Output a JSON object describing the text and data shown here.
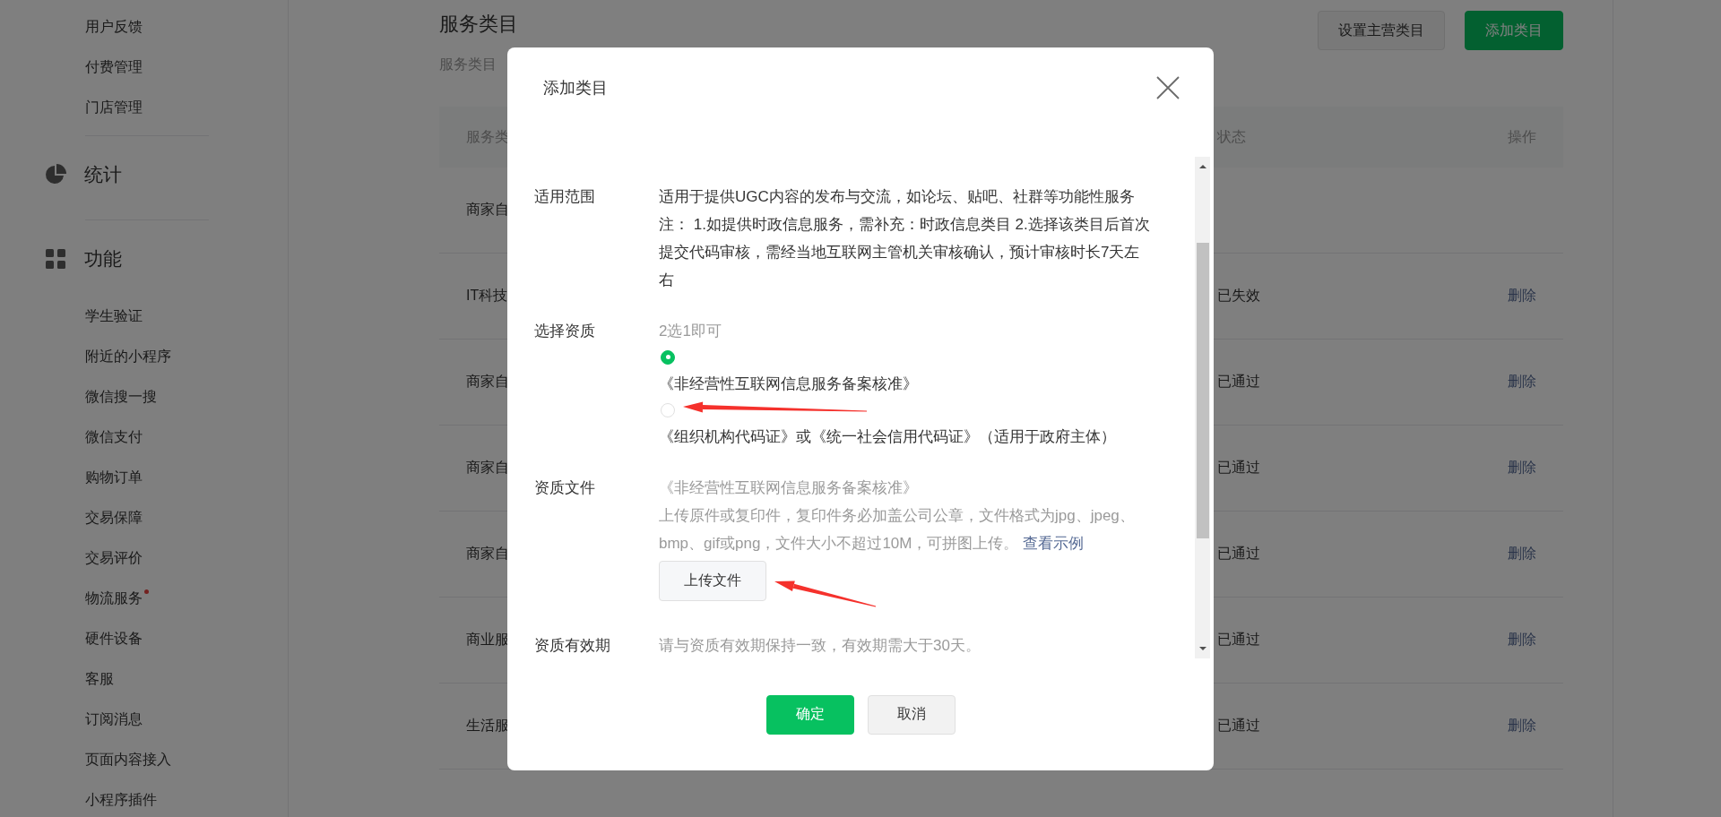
{
  "sidebar": {
    "top_items": [
      {
        "label": "用户反馈",
        "dot": false
      },
      {
        "label": "付费管理",
        "dot": false
      },
      {
        "label": "门店管理",
        "dot": false
      }
    ],
    "sections": [
      {
        "kind": "stats",
        "title": "统计"
      },
      {
        "kind": "features",
        "title": "功能",
        "items": [
          {
            "label": "学生验证",
            "dot": false
          },
          {
            "label": "附近的小程序",
            "dot": false
          },
          {
            "label": "微信搜一搜",
            "dot": false
          },
          {
            "label": "微信支付",
            "dot": false
          },
          {
            "label": "购物订单",
            "dot": false
          },
          {
            "label": "交易保障",
            "dot": false
          },
          {
            "label": "交易评价",
            "dot": false
          },
          {
            "label": "物流服务",
            "dot": true
          },
          {
            "label": "硬件设备",
            "dot": false
          },
          {
            "label": "客服",
            "dot": false
          },
          {
            "label": "订阅消息",
            "dot": false
          },
          {
            "label": "页面内容接入",
            "dot": false
          },
          {
            "label": "小程序插件",
            "dot": false
          }
        ]
      }
    ]
  },
  "main": {
    "title": "服务类目",
    "subtitle": "服务类目",
    "buttons": [
      {
        "label": "设置主营类目",
        "kind": "secondary"
      },
      {
        "label": "添加类目",
        "kind": "primary"
      }
    ],
    "table": {
      "columns": [
        "服务类",
        "状态",
        "操作"
      ],
      "rows": [
        {
          "column_1": "商家自"
        },
        {
          "column_1": "IT科技",
          "status": "已失效",
          "action": "删除"
        },
        {
          "column_1": "商家自",
          "status": "已通过",
          "action": "删除"
        },
        {
          "column_1": "商家自",
          "status": "已通过",
          "action": "删除"
        },
        {
          "column_1": "商家自",
          "status": "已通过",
          "action": "删除"
        },
        {
          "column_1": "商业服",
          "status": "已通过",
          "action": "删除"
        },
        {
          "column_1": "生活服",
          "status": "已通过",
          "action": "删除"
        }
      ]
    }
  },
  "modal": {
    "title": "添加类目",
    "fields": [
      {
        "kind": "text",
        "label": "适用范围",
        "paragraphs": [
          "适用于提供UGC内容的发布与交流，如论坛、贴吧、社群等功能性服务",
          "注： 1.如提供时政信息服务，需补充：时政信息类目 2.选择该类目后首次提交代码审核，需经当地互联网主管机关审核确认，预计审核时长7天左右"
        ]
      },
      {
        "kind": "radio",
        "label": "选择资质",
        "hint": "2选1即可",
        "options": [
          {
            "label": "《非经营性互联网信息服务备案核准》",
            "selected": true
          },
          {
            "label": "《组织机构代码证》或《统一社会信用代码证》（适用于政府主体）",
            "selected": false
          }
        ]
      },
      {
        "kind": "upload",
        "label": "资质文件",
        "document": "《非经营性互联网信息服务备案核准》",
        "description": "上传原件或复印件，复印件务必加盖公司公章，文件格式为jpg、jpeg、bmp、gif或png，文件大小不超过10M，可拼图上传。",
        "link": "查看示例",
        "button": "上传文件"
      },
      {
        "kind": "hint",
        "label": "资质有效期",
        "text": "请与资质有效期保持一致，有效期需大于30天。"
      }
    ],
    "buttons": [
      {
        "label": "确定",
        "kind": "primary"
      },
      {
        "label": "取消",
        "kind": "secondary"
      }
    ]
  }
}
